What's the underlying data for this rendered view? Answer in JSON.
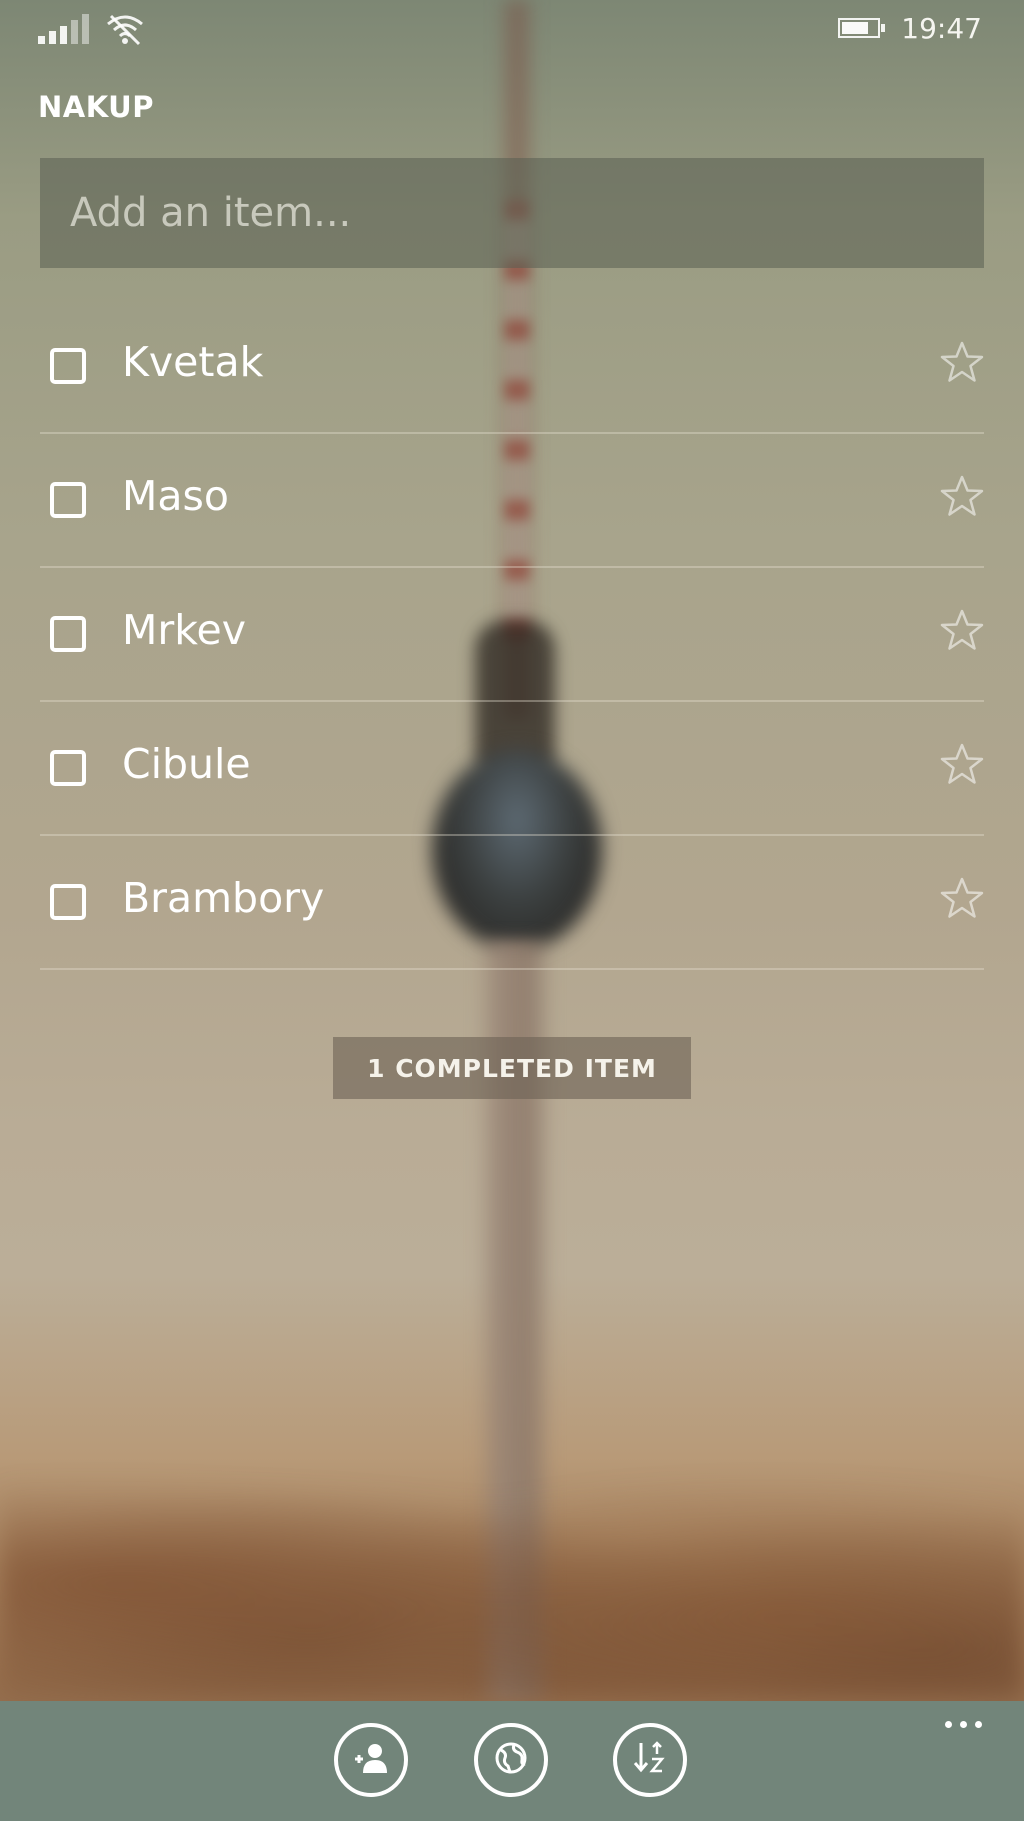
{
  "status_bar": {
    "signal_icon": "signal-strength-icon",
    "wifi_icon": "wifi-icon",
    "battery_icon": "battery-icon",
    "battery_level": 0.75,
    "time": "19:47"
  },
  "list": {
    "title": "NAKUP",
    "add_placeholder": "Add an item...",
    "items": [
      {
        "label": "Kvetak",
        "checked": false,
        "starred": false
      },
      {
        "label": "Maso",
        "checked": false,
        "starred": false
      },
      {
        "label": "Mrkev",
        "checked": false,
        "starred": false
      },
      {
        "label": "Cibule",
        "checked": false,
        "starred": false
      },
      {
        "label": "Brambory",
        "checked": false,
        "starred": false
      }
    ],
    "completed_label": "1 COMPLETED ITEM"
  },
  "app_bar": {
    "buttons": [
      {
        "icon": "share-list-icon"
      },
      {
        "icon": "globe-icon"
      },
      {
        "icon": "sort-icon"
      }
    ],
    "more_icon": "more-options-icon",
    "background": "#72857a"
  },
  "colors": {
    "text": "#ffffff",
    "input_background": "rgba(90,95,82,0.55)",
    "completed_button_background": "rgba(110,98,85,0.62)"
  }
}
